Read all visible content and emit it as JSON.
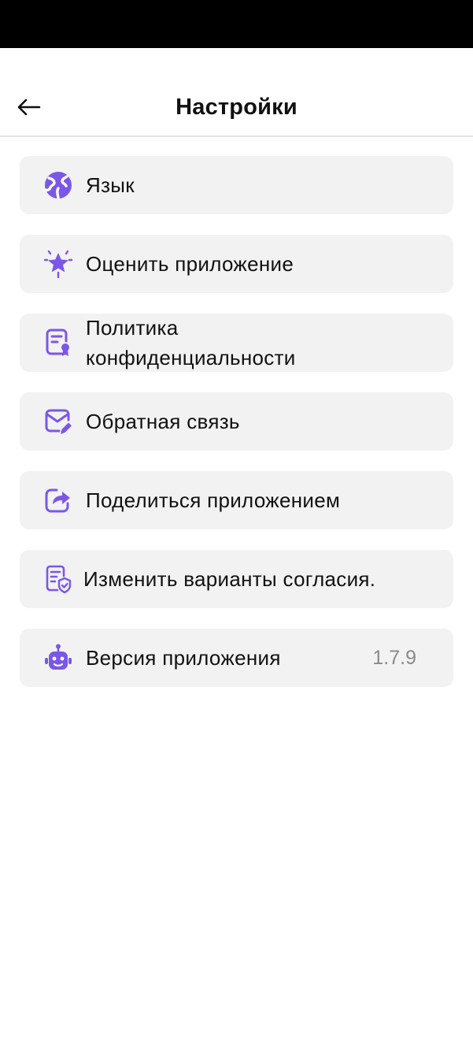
{
  "header": {
    "title": "Настройки",
    "back_icon": "arrow-left-icon"
  },
  "settings": {
    "items": [
      {
        "label": "Язык",
        "icon": "globe-icon"
      },
      {
        "label": "Оценить приложение",
        "icon": "star-icon"
      },
      {
        "label": "Политика конфиденциальности",
        "icon": "document-badge-icon"
      },
      {
        "label": "Обратная связь",
        "icon": "mail-edit-icon"
      },
      {
        "label": "Поделиться приложением",
        "icon": "share-icon"
      },
      {
        "label": "Изменить варианты согласия.",
        "icon": "document-shield-icon"
      },
      {
        "label": "Версия приложения",
        "icon": "robot-icon",
        "value": "1.7.9"
      }
    ]
  },
  "colors": {
    "accent": "#7b57e8",
    "item_background": "#f2f2f2",
    "secondary_text": "#8a8a8e"
  }
}
